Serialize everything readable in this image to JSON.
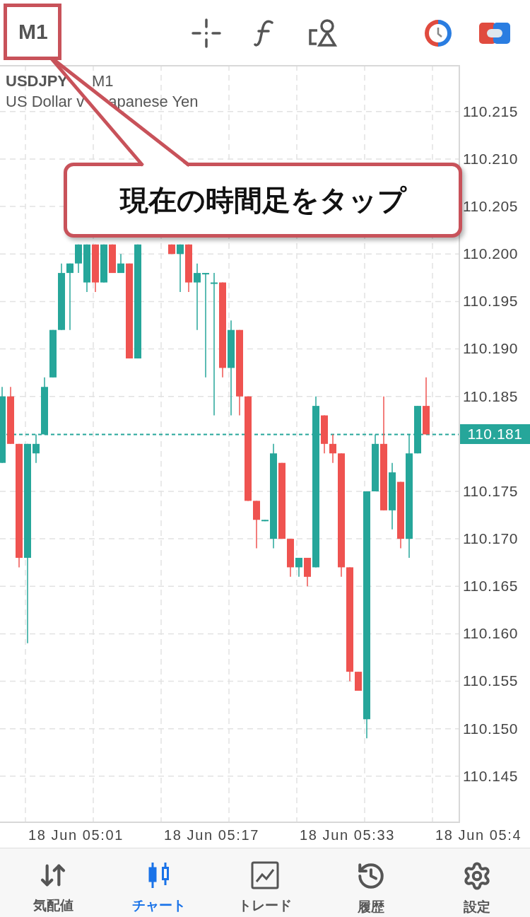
{
  "top_bar": {
    "timeframe": "M1",
    "tools": [
      {
        "kind": "crosshair"
      },
      {
        "kind": "function"
      },
      {
        "kind": "objects"
      },
      {
        "kind": "timeframes"
      },
      {
        "kind": "trade"
      }
    ]
  },
  "chart": {
    "symbol": "USDJPY",
    "timeframe": "M1",
    "description": [
      "US Dollar v",
      "apanese Yen"
    ],
    "time_labels": [
      "18 Jun 05:01",
      "18 Jun 05:17",
      "18 Jun 05:33",
      "18 Jun 05:4"
    ],
    "chart_data": {
      "type": "candlestick",
      "ylim": [
        110.14,
        110.2199
      ],
      "yticks": [
        {
          "value": 110.215,
          "label": "110.215"
        },
        {
          "value": 110.21,
          "label": "110.210"
        },
        {
          "value": 110.205,
          "label": "110.205"
        },
        {
          "value": 110.2,
          "label": "110.200"
        },
        {
          "value": 110.195,
          "label": "110.195"
        },
        {
          "value": 110.19,
          "label": "110.190"
        },
        {
          "value": 110.185,
          "label": "110.185"
        },
        {
          "value": 110.175,
          "label": "110.175"
        },
        {
          "value": 110.17,
          "label": "110.170"
        },
        {
          "value": 110.165,
          "label": "110.165"
        },
        {
          "value": 110.16,
          "label": "110.160"
        },
        {
          "value": 110.155,
          "label": "110.155"
        },
        {
          "value": 110.15,
          "label": "110.150"
        },
        {
          "value": 110.145,
          "label": "110.145"
        }
      ],
      "ref_lines": [
        {
          "axis": "y",
          "value": 110.181,
          "label": "110.181"
        }
      ],
      "grid": true,
      "categories": [
        null,
        null,
        null,
        null,
        null,
        null,
        null,
        null,
        null,
        null,
        null,
        null,
        null,
        null,
        null,
        null,
        null,
        null,
        null,
        null,
        null,
        null,
        null,
        null,
        null,
        null,
        null,
        null,
        null,
        null,
        null,
        null,
        null,
        null,
        null,
        null,
        null,
        null,
        null,
        null,
        null,
        null,
        null,
        null,
        null,
        null,
        null,
        null,
        null,
        null,
        null
      ],
      "ohlc": [
        [
          110.178,
          110.186,
          110.178,
          110.185
        ],
        [
          110.185,
          110.186,
          110.18,
          110.18
        ],
        [
          110.18,
          110.18,
          110.167,
          110.168
        ],
        [
          110.168,
          110.18,
          110.159,
          110.18
        ],
        [
          110.179,
          110.181,
          110.178,
          110.18
        ],
        [
          110.181,
          110.187,
          110.181,
          110.186
        ],
        [
          110.187,
          110.192,
          110.187,
          110.192
        ],
        [
          110.192,
          110.199,
          110.192,
          110.198
        ],
        [
          110.198,
          110.199,
          110.192,
          110.199
        ],
        [
          110.199,
          110.201,
          110.198,
          110.201
        ],
        [
          110.197,
          110.201,
          110.196,
          110.201
        ],
        [
          110.201,
          110.201,
          110.196,
          110.197
        ],
        [
          110.197,
          110.201,
          110.197,
          110.201
        ],
        [
          110.201,
          110.201,
          110.198,
          110.198
        ],
        [
          110.198,
          110.2,
          110.198,
          110.199
        ],
        [
          110.199,
          110.199,
          110.189,
          110.189
        ],
        [
          110.189,
          110.201,
          110.189,
          110.201
        ],
        null,
        null,
        null,
        [
          110.201,
          110.201,
          110.2,
          110.2
        ],
        [
          110.2,
          110.201,
          110.196,
          110.201
        ],
        [
          110.201,
          110.201,
          110.196,
          110.197
        ],
        [
          110.197,
          110.199,
          110.192,
          110.198
        ],
        [
          110.198,
          110.198,
          110.187,
          110.198
        ],
        [
          110.197,
          110.198,
          110.183,
          110.197
        ],
        [
          110.197,
          110.197,
          110.187,
          110.188
        ],
        [
          110.188,
          110.193,
          110.183,
          110.192
        ],
        [
          110.192,
          110.192,
          110.183,
          110.185
        ],
        [
          110.185,
          110.185,
          110.174,
          110.174
        ],
        [
          110.174,
          110.174,
          110.169,
          110.172
        ],
        [
          110.172,
          110.172,
          110.172,
          110.172
        ],
        [
          110.17,
          110.18,
          110.169,
          110.179
        ],
        [
          110.178,
          110.178,
          110.17,
          110.17
        ],
        [
          110.17,
          110.17,
          110.166,
          110.167
        ],
        [
          110.167,
          110.168,
          110.166,
          110.168
        ],
        [
          110.168,
          110.168,
          110.165,
          110.166
        ],
        [
          110.167,
          110.185,
          110.167,
          110.184
        ],
        [
          110.183,
          110.183,
          110.179,
          110.18
        ],
        [
          110.18,
          110.181,
          110.178,
          110.179
        ],
        [
          110.179,
          110.179,
          110.166,
          110.167
        ],
        [
          110.167,
          110.167,
          110.155,
          110.156
        ],
        [
          110.156,
          110.156,
          110.154,
          110.154
        ],
        [
          110.151,
          110.175,
          110.149,
          110.175
        ],
        [
          110.175,
          110.181,
          110.175,
          110.18
        ],
        [
          110.18,
          110.185,
          110.173,
          110.173
        ],
        [
          110.173,
          110.178,
          110.171,
          110.177
        ],
        [
          110.176,
          110.176,
          110.169,
          110.17
        ],
        [
          110.17,
          110.181,
          110.168,
          110.179
        ],
        [
          110.179,
          110.184,
          110.179,
          110.184
        ],
        [
          110.184,
          110.187,
          110.181,
          110.181
        ]
      ]
    }
  },
  "annotation": {
    "text": "現在の時間足をタップ"
  },
  "nav": [
    {
      "label": "気配値",
      "kind": "quotes",
      "selected": false
    },
    {
      "label": "チャート",
      "kind": "chart",
      "selected": true
    },
    {
      "label": "トレード",
      "kind": "trade",
      "selected": false
    },
    {
      "label": "履歴",
      "kind": "history",
      "selected": false
    },
    {
      "label": "設定",
      "kind": "settings",
      "selected": false
    }
  ]
}
